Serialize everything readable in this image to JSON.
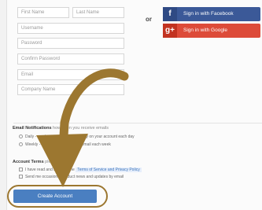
{
  "form": {
    "first_name_placeholder": "First Name",
    "last_name_placeholder": "Last Name",
    "username_placeholder": "Username",
    "password_placeholder": "Password",
    "confirm_password_placeholder": "Confirm Password",
    "email_placeholder": "Email",
    "company_placeholder": "Company Name"
  },
  "divider_or": "or",
  "social": {
    "facebook_label": "Sign in with Facebook",
    "google_label": "Sign in with Google"
  },
  "email_section": {
    "title": "Email Notifications",
    "subtitle": "how often you receive emails",
    "option_1": "Daily - receive a summary of activity on your account each day",
    "option_2": "Weekly - receive a single digest email each week"
  },
  "terms_section": {
    "title": "Account Terms",
    "subtitle": "please read",
    "line_1": "I have read and agree to the",
    "line_1_link": "Terms of Service and Privacy Policy",
    "line_2": "Send me occasional product news and updates by email"
  },
  "submit_label": "Create Account",
  "colors": {
    "facebook": "#3b5998",
    "google": "#dd4b39",
    "primary_button": "#4a7fc1",
    "annotation": "#9c7730"
  },
  "icons": {
    "facebook": "facebook-icon",
    "google": "google-plus-icon",
    "annotation_arrow": "curved-arrow-icon"
  }
}
